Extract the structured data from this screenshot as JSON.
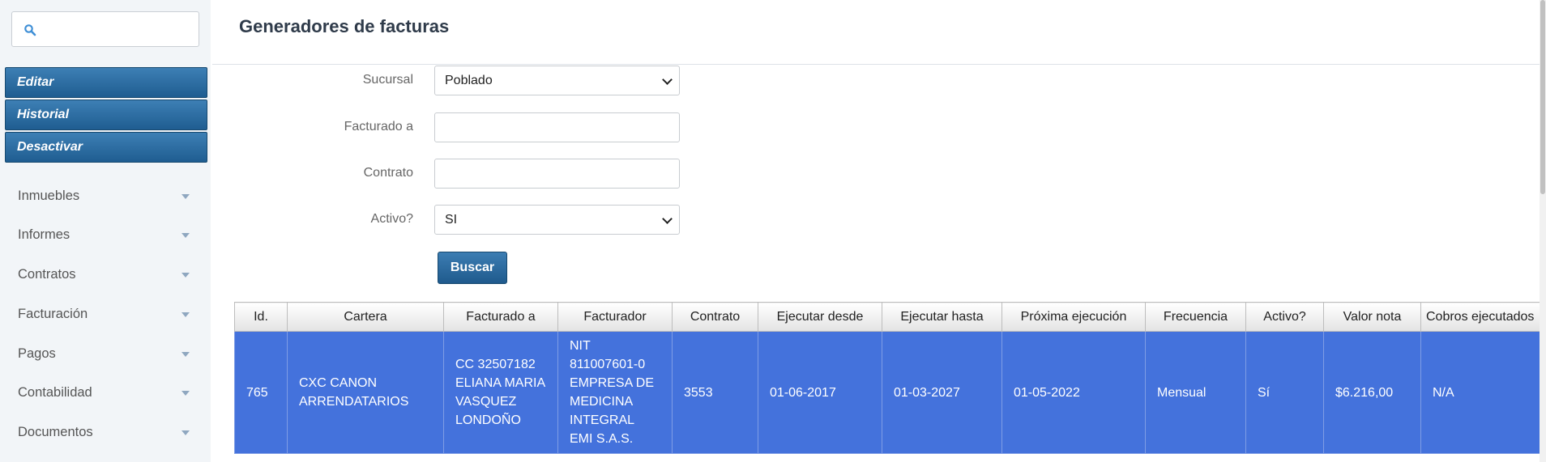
{
  "search": {
    "placeholder": "",
    "value": ""
  },
  "actions": [
    {
      "label": "Editar"
    },
    {
      "label": "Historial"
    },
    {
      "label": "Desactivar"
    }
  ],
  "nav": [
    {
      "label": "Inmuebles"
    },
    {
      "label": "Informes"
    },
    {
      "label": "Contratos"
    },
    {
      "label": "Facturación"
    },
    {
      "label": "Pagos"
    },
    {
      "label": "Contabilidad"
    },
    {
      "label": "Documentos"
    }
  ],
  "page": {
    "title": "Generadores de facturas"
  },
  "form": {
    "sucursal": {
      "label": "Sucursal",
      "value": "Poblado"
    },
    "facturado_a": {
      "label": "Facturado a",
      "value": ""
    },
    "contrato": {
      "label": "Contrato",
      "value": ""
    },
    "activo": {
      "label": "Activo?",
      "value": "SI"
    },
    "buscar": "Buscar"
  },
  "table": {
    "headers": [
      "Id.",
      "Cartera",
      "Facturado a",
      "Facturador",
      "Contrato",
      "Ejecutar desde",
      "Ejecutar hasta",
      "Próxima ejecución",
      "Frecuencia",
      "Activo?",
      "Valor nota",
      "Cobros ejecutados"
    ],
    "rows": [
      {
        "id": "765",
        "cartera": "CXC CANON ARRENDATARIOS",
        "facturado_a": "CC 32507182 ELIANA MARIA VASQUEZ LONDOÑO",
        "facturador": "NIT 811007601-0 EMPRESA DE MEDICINA INTEGRAL EMI S.A.S.",
        "contrato": "3553",
        "ejecutar_desde": "01-06-2017",
        "ejecutar_hasta": "01-03-2027",
        "proxima_ejecucion": "01-05-2022",
        "frecuencia": "Mensual",
        "activo": "Sí",
        "valor_nota": "$6.216,00",
        "cobros_ejecutados": "N/A"
      }
    ]
  },
  "colors": {
    "button": "#2a6aa1",
    "selected_row": "#4472dc",
    "sidebar_bg": "#f2f5f8"
  }
}
